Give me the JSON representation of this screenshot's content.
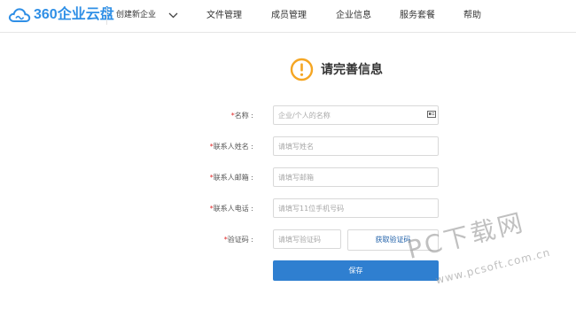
{
  "header": {
    "logo_text": "360企业云盘",
    "org_switch_label": "创建新企业",
    "nav": [
      "文件管理",
      "成员管理",
      "企业信息",
      "服务套餐",
      "帮助"
    ]
  },
  "page": {
    "title": "请完善信息"
  },
  "form": {
    "required_mark": "*",
    "fields": {
      "name": {
        "label": "名称 :",
        "placeholder": "企业/个人的名称"
      },
      "contact_name": {
        "label": "联系人姓名 :",
        "placeholder": "请填写姓名"
      },
      "contact_email": {
        "label": "联系人邮箱 :",
        "placeholder": "请填写邮箱"
      },
      "contact_phone": {
        "label": "联系人电话 :",
        "placeholder": "请填写11位手机号码"
      },
      "verify_code": {
        "label": "验证码 :",
        "placeholder": "请填写验证码"
      }
    },
    "get_code_label": "获取验证码",
    "save_label": "保存"
  },
  "watermark": {
    "main": "PC下载网",
    "url": "www.pcsoft.com.cn"
  },
  "colors": {
    "brand": "#2f8fe6",
    "primary_button": "#2f7fd0",
    "required": "#e02b2b",
    "warning_icon": "#f5a623"
  }
}
